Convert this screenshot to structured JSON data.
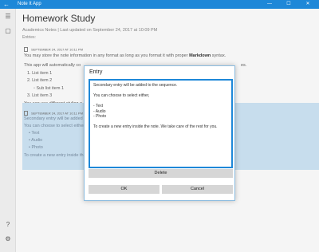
{
  "window": {
    "title": "Note It App",
    "back_glyph": "←",
    "minimize_glyph": "—",
    "maximize_glyph": "☐",
    "close_glyph": "✕",
    "accent": "#1e88d8"
  },
  "sidebar": {
    "menu_glyph": "☰",
    "note_glyph": "▢",
    "help_glyph": "?",
    "settings_glyph": "⚙"
  },
  "note": {
    "title": "Homework Study",
    "meta": "Academics Notes | Last updated on September 24, 2017 at 10:09 PM",
    "entries_label": "Entries:",
    "entry1_stamp": "SEPTEMBER 24, 2017 AT 10:11 PM",
    "entry1_line1_a": "You may store the note information in any format as long as you format it with proper ",
    "entry1_line1_b": "Markdown",
    "entry1_line1_c": " syntax.",
    "entry1_line2": "This app will automatically co",
    "entry1_line2_tail": "es.",
    "list_item1": "1.  List item 1",
    "list_item2": "2.  List item 2",
    "sub_item": "◦  Sub list item 1",
    "list_item3": "3.  List item 3",
    "entry1_line3": "You can use different styling o",
    "entry2_stamp": "SEPTEMBER 24, 2017 AT 10:11 PM",
    "entry2_line1": "Secondary entry will be added",
    "entry2_line2": "You can choose to select either",
    "bullet_text": "•  Text",
    "bullet_audio": "•  Audio",
    "bullet_photo": "•  Photo",
    "entry2_line3": "To create a new entry inside th"
  },
  "dialog": {
    "title": "Entry",
    "lines": [
      "Secondary entry will be added to the sequence.",
      "",
      "You can choose to select either,",
      "",
      "- Text",
      "- Audio",
      "- Photo",
      "",
      "To create a new entry inside the note. We take care of the rest for you."
    ],
    "delete_label": "Delete",
    "ok_label": "OK",
    "cancel_label": "Cancel"
  }
}
